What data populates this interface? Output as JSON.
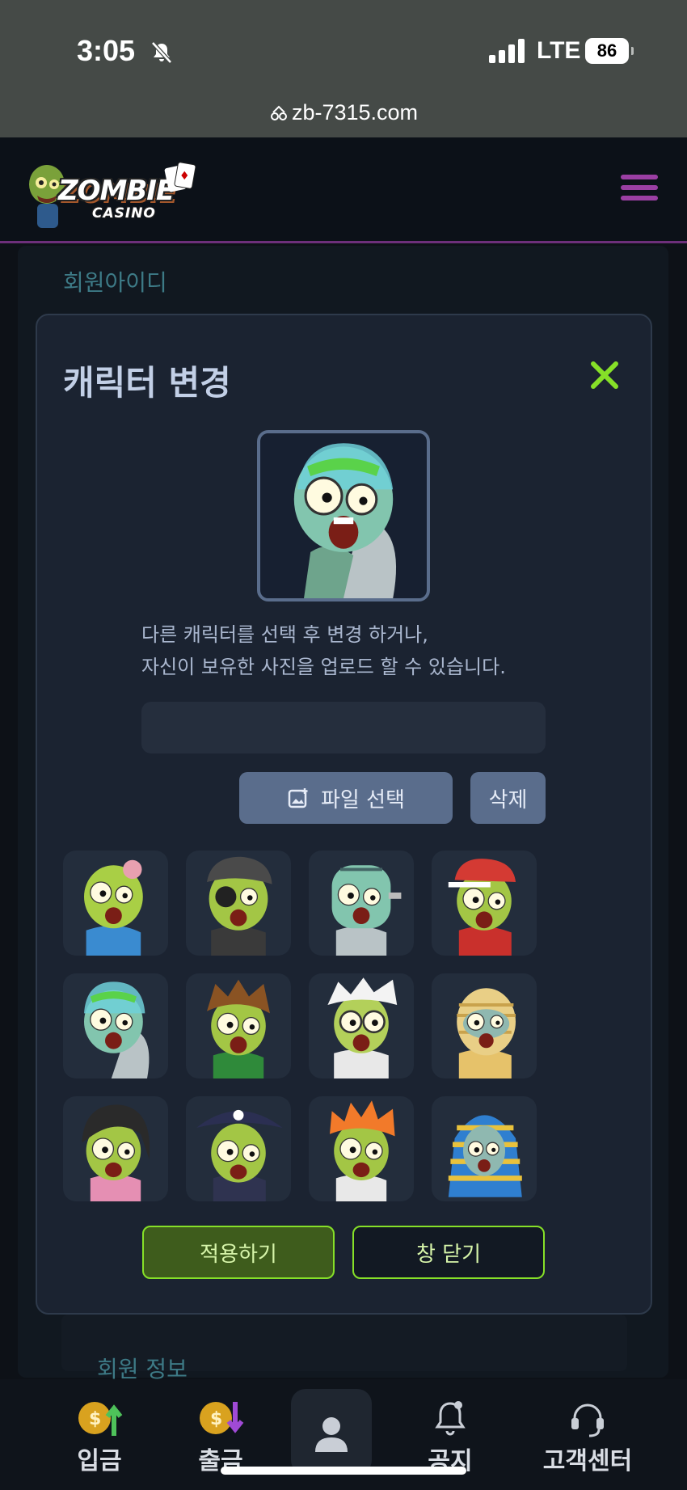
{
  "status_bar": {
    "time": "3:05",
    "network": "LTE",
    "battery": "86",
    "url": "zb-7315.com"
  },
  "header": {
    "logo_title": "ZOMBIE",
    "logo_subtitle": "CASINO"
  },
  "background": {
    "member_id_label": "회원아이디",
    "member_info_label": "회원 정보"
  },
  "modal": {
    "title": "캐릭터 변경",
    "description_line1": "다른 캐릭터를 선택 후 변경 하거나,",
    "description_line2": "자신이 보유한 사진을 업로드 할 수 있습니다.",
    "file_field_value": "",
    "file_button_label": "파일 선택",
    "delete_button_label": "삭제",
    "apply_button_label": "적용하기",
    "close_button_label": "창 닫기",
    "selected_character": "zombie-helmet",
    "characters": [
      "zombie-brain",
      "zombie-beanie",
      "zombie-frankenstein",
      "zombie-cap",
      "zombie-helmet",
      "zombie-brown-hair",
      "zombie-scientist",
      "zombie-mummy",
      "zombie-black-hair",
      "zombie-pirate",
      "zombie-punk",
      "zombie-pharaoh"
    ]
  },
  "bottom_nav": {
    "items": [
      {
        "label": "입금",
        "icon": "deposit-icon"
      },
      {
        "label": "출금",
        "icon": "withdraw-icon"
      },
      {
        "label": "",
        "icon": "profile-icon"
      },
      {
        "label": "공지",
        "icon": "notice-bell-icon"
      },
      {
        "label": "고객센터",
        "icon": "headset-icon"
      }
    ]
  },
  "colors": {
    "accent_green": "#86e028",
    "brand_purple": "#9b3fa3",
    "button_slate": "#5a6d8c",
    "modal_bg": "#1b2331"
  }
}
